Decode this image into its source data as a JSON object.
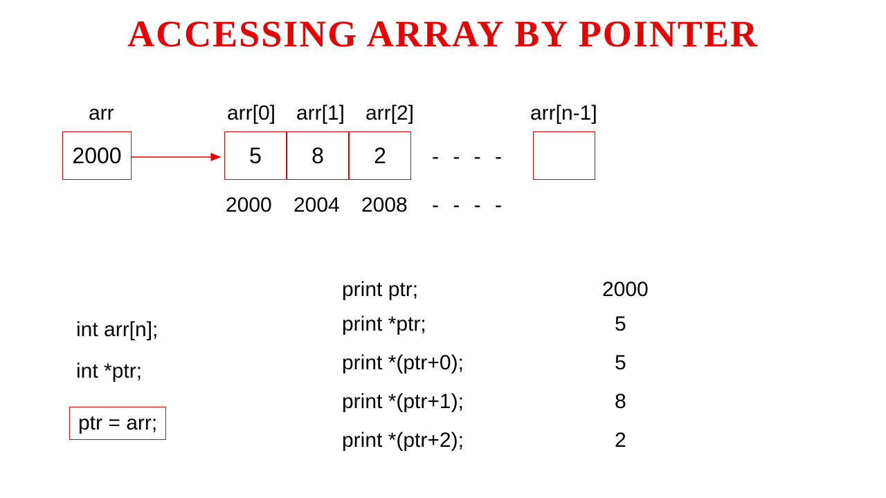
{
  "title": "ACCESSING ARRAY BY POINTER",
  "arr_label": "arr",
  "arr_box_value": "2000",
  "cells": {
    "labels": [
      "arr[0]",
      "arr[1]",
      "arr[2]"
    ],
    "values": [
      "5",
      "8",
      "2"
    ],
    "addresses": [
      "2000",
      "2004",
      "2008"
    ]
  },
  "last_label": "arr[n-1]",
  "dashes_top": "- - - -",
  "dashes_bottom": "-  -  -  -",
  "code": {
    "decl1": "int arr[n];",
    "decl2": "int *ptr;",
    "assign": "ptr = arr;"
  },
  "prints": [
    {
      "stmt": "print ptr;",
      "val": "2000"
    },
    {
      "stmt": "print *ptr;",
      "val": "5"
    },
    {
      "stmt": "print *(ptr+0);",
      "val": "5"
    },
    {
      "stmt": "print *(ptr+1);",
      "val": "8"
    },
    {
      "stmt": "print *(ptr+2);",
      "val": "2"
    }
  ]
}
